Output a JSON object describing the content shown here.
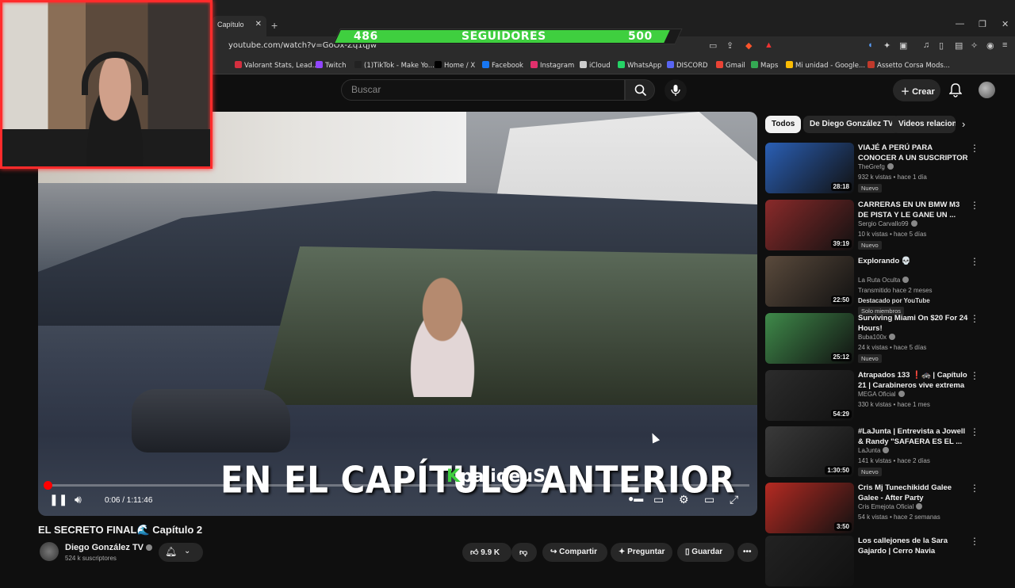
{
  "browser": {
    "tab_title": "Capítulo",
    "url": "youtube.com/watch?v=GoOx-Zq1qJw",
    "bookmarks": [
      {
        "label": "Valorant Stats, Lead...",
        "color": "#d42f3f"
      },
      {
        "label": "Twitch",
        "color": "#9146ff"
      },
      {
        "label": "(1)TikTok - Make Yo...",
        "color": "#222222"
      },
      {
        "label": "Home / X",
        "color": "#000000"
      },
      {
        "label": "Facebook",
        "color": "#1877f2"
      },
      {
        "label": "Instagram",
        "color": "#e1306c"
      },
      {
        "label": "iCloud",
        "color": "#cccccc"
      },
      {
        "label": "WhatsApp",
        "color": "#25d366"
      },
      {
        "label": "DISCORD",
        "color": "#5865f2"
      },
      {
        "label": "Gmail",
        "color": "#ea4335"
      },
      {
        "label": "Maps",
        "color": "#34a853"
      },
      {
        "label": "Mi unidad - Google...",
        "color": "#fbbc04"
      },
      {
        "label": "Assetto Corsa Mods...",
        "color": "#c0392b"
      }
    ]
  },
  "followers": {
    "current": "486",
    "label": "SEGUIDORES",
    "goal": "500",
    "progress_fraction": 0.97,
    "color": "#3fcf3f"
  },
  "youtube": {
    "search_placeholder": "Buscar",
    "create_label": "Crear"
  },
  "video": {
    "subtitle": "EN EL CAPÍTULO ANTERIOR",
    "watermark": "palideuS",
    "watermark_prefix": "K",
    "time": "0:06 / 1:11:46",
    "progress_fraction": 0.0014,
    "title": "EL SECRETO FINAL🌊 Capítulo 2",
    "channel": "Diego González TV",
    "subscribers": "524 k suscriptores",
    "likes": "9.9 K",
    "share_label": "Compartir",
    "ask_label": "Preguntar",
    "save_label": "Guardar"
  },
  "sidebar": {
    "chips": [
      "Todos",
      "De Diego González TV",
      "Videos relacion"
    ],
    "recommendations": [
      {
        "title": "VIAJÉ A PERÚ PARA CONOCER A UN SUSCRIPTOR",
        "channel": "TheGrefg",
        "meta": "932 k vistas • hace 1 día",
        "badge": "Nuevo",
        "duration": "28:18",
        "thumb_color": "#2a5fb5"
      },
      {
        "title": "CARRERAS EN UN BMW M3 DE PISTA Y LE GANE UN ...",
        "channel": "Sergio Carvallo99",
        "meta": "10 k vistas • hace 5 días",
        "badge": "Nuevo",
        "duration": "39:19",
        "thumb_color": "#8a2a2a"
      },
      {
        "title": "Explorando 💀",
        "channel": "La Ruta Oculta",
        "meta": "Transmitido hace 2 meses",
        "extra": "Destacado por YouTube",
        "badge": "Solo miembros",
        "duration": "22:50",
        "thumb_color": "#5a4a3c"
      },
      {
        "title": "Surviving Miami On $20 For 24 Hours!",
        "channel": "Buba100x",
        "meta": "24 k vistas • hace 5 días",
        "badge": "Nuevo",
        "duration": "25:12",
        "thumb_color": "#3f8a4a"
      },
      {
        "title": "Atrapados 133 ❗🚓 | Capítulo 21 | Carabineros vive extrema ...",
        "channel": "MEGA Oficial",
        "meta": "330 k vistas • hace 1 mes",
        "duration": "54:29",
        "thumb_color": "#2c2c2c"
      },
      {
        "title": "#LaJunta | Entrevista a Jowell & Randy \"SAFAERA ES EL ...",
        "channel": "LaJunta",
        "meta": "141 k vistas • hace 2 días",
        "badge": "Nuevo",
        "duration": "1:30:50",
        "thumb_color": "#3a3a3a"
      },
      {
        "title": "Cris Mj Tunechikidd Galee Galee - After Party",
        "channel": "Cris Emejota Oficial",
        "meta": "54 k vistas • hace 2 semanas",
        "duration": "3:50",
        "thumb_color": "#b52a22"
      },
      {
        "title": "Los callejones de la Sara Gajardo | Cerro Navia",
        "channel": "",
        "meta": "",
        "duration": "",
        "thumb_color": "#222222"
      }
    ]
  }
}
